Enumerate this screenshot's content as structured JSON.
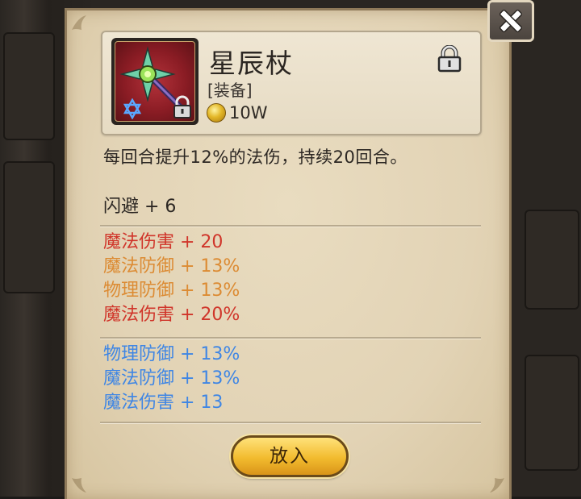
{
  "item": {
    "name": "星辰杖",
    "type": "[装备]",
    "price": "10W",
    "description": "每回合提升12%的法伤，持续20回合。"
  },
  "base_stats": [
    {
      "text": "闪避 + 6"
    }
  ],
  "bonus_stats": [
    {
      "text": "魔法伤害 + 20",
      "color": "#d0352a"
    },
    {
      "text": "魔法防御 + 13%",
      "color": "#dc8b33"
    },
    {
      "text": "物理防御 + 13%",
      "color": "#dc8b33"
    },
    {
      "text": "魔法伤害 + 20%",
      "color": "#d0352a"
    }
  ],
  "extra_stats": [
    {
      "text": "物理防御 + 13%",
      "color": "#3f86e4"
    },
    {
      "text": "魔法防御 + 13%",
      "color": "#3f86e4"
    },
    {
      "text": "魔法伤害 + 13",
      "color": "#3f86e4"
    }
  ],
  "buttons": {
    "action_label": "放入"
  },
  "icons": {
    "close": "close-icon",
    "lock": "lock-icon",
    "coin": "coin-icon",
    "star": "star-icon"
  }
}
